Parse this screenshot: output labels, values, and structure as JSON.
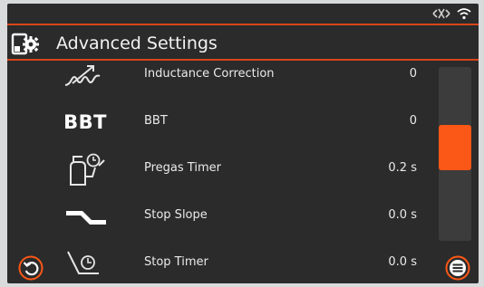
{
  "title": "Advanced Settings",
  "status_icons": [
    "bluetooth-icon",
    "wifi-icon"
  ],
  "colors": {
    "accent": "#fb5716",
    "line": "#d9461b",
    "background": "#2b2b2b"
  },
  "rows": [
    {
      "icon": "inductance-icon",
      "label": "Inductance Correction",
      "value": "0"
    },
    {
      "icon": "bbt-icon",
      "icon_text": "BBT",
      "label": "BBT",
      "value": "0"
    },
    {
      "icon": "pregas-timer-icon",
      "label": "Pregas Timer",
      "value": "0.2 s"
    },
    {
      "icon": "stop-slope-icon",
      "label": "Stop Slope",
      "value": "0.0 s"
    },
    {
      "icon": "stop-timer-icon",
      "label": "Stop Timer",
      "value": "0.0 s"
    }
  ],
  "scrollbar": {
    "position_fraction": 0.42,
    "visible_fraction": 0.42
  },
  "buttons": {
    "back": "back-icon",
    "menu": "menu-icon"
  }
}
